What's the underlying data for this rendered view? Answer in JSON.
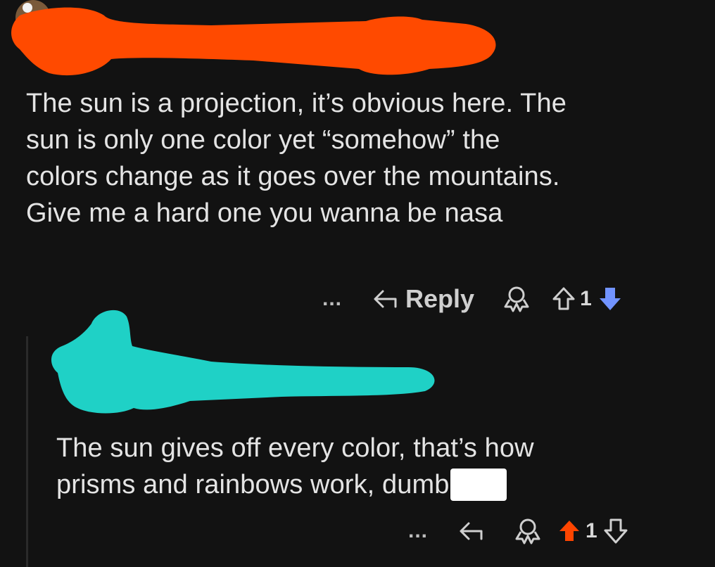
{
  "comment_1": {
    "username": "",
    "text_lines": [
      "The sun is a projection, it’s obvious here. The",
      "sun is only one color yet “somehow” the",
      "colors change as it goes over the mountains.",
      "Give me a hard one you wanna be nasa"
    ],
    "actions": {
      "more": "...",
      "reply_label": "Reply",
      "vote_count": "1",
      "vote_state": "downvoted"
    }
  },
  "comment_2": {
    "username": "",
    "text_lines": [
      "The sun gives off every color, that’s how",
      "prisms and rainbows work, dumb"
    ],
    "actions": {
      "more": "...",
      "vote_count": "1",
      "vote_state": "upvoted"
    }
  },
  "colors": {
    "background": "#121212",
    "redaction_top": "#ff4a00",
    "redaction_reply": "#1fd1c6",
    "upvote_active": "#ff4500",
    "downvote_active": "#7193ff"
  }
}
